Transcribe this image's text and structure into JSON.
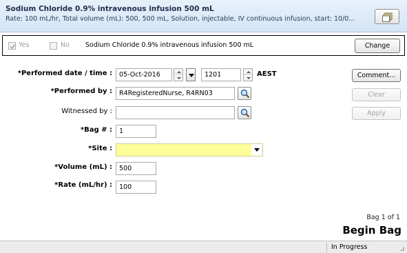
{
  "header": {
    "title": "Sodium Chloride 0.9% intravenous infusion 500 mL",
    "subtitle": "Rate: 100 mL/hr, Total volume (mL): 500, 500 mL, Solution, injectable, IV continuous infusion, start: 10/0...",
    "view_icon": "documents-icon"
  },
  "order": {
    "yes_label": "Yes",
    "yes_checked": true,
    "no_label": "No",
    "no_checked": false,
    "order_text": "Sodium Chloride 0.9% intravenous infusion 500 mL",
    "change_label": "Change"
  },
  "form": {
    "performed_datetime_label": "*Performed date / time :",
    "date_value": "05-Oct-2016",
    "time_value": "1201",
    "timezone": "AEST",
    "performed_by_label": "*Performed by :",
    "performed_by_value": "R4RegisteredNurse, R4RN03",
    "witnessed_by_label": "Witnessed by :",
    "witnessed_by_value": "",
    "bag_label": "*Bag # :",
    "bag_value": "1",
    "site_label": "*Site :",
    "site_value": "",
    "volume_label": "*Volume (mL) :",
    "volume_value": "500",
    "rate_label": "*Rate (mL/hr) :",
    "rate_value": "100"
  },
  "buttons": {
    "comment": "Comment...",
    "clear": "Clear",
    "apply": "Apply"
  },
  "footer": {
    "bag_count": "Bag 1 of 1",
    "action": "Begin Bag",
    "status": "In Progress"
  },
  "colors": {
    "header_bg": "#d9e8f7",
    "required_field": "#ffff99",
    "status_bar": "#ececec"
  }
}
